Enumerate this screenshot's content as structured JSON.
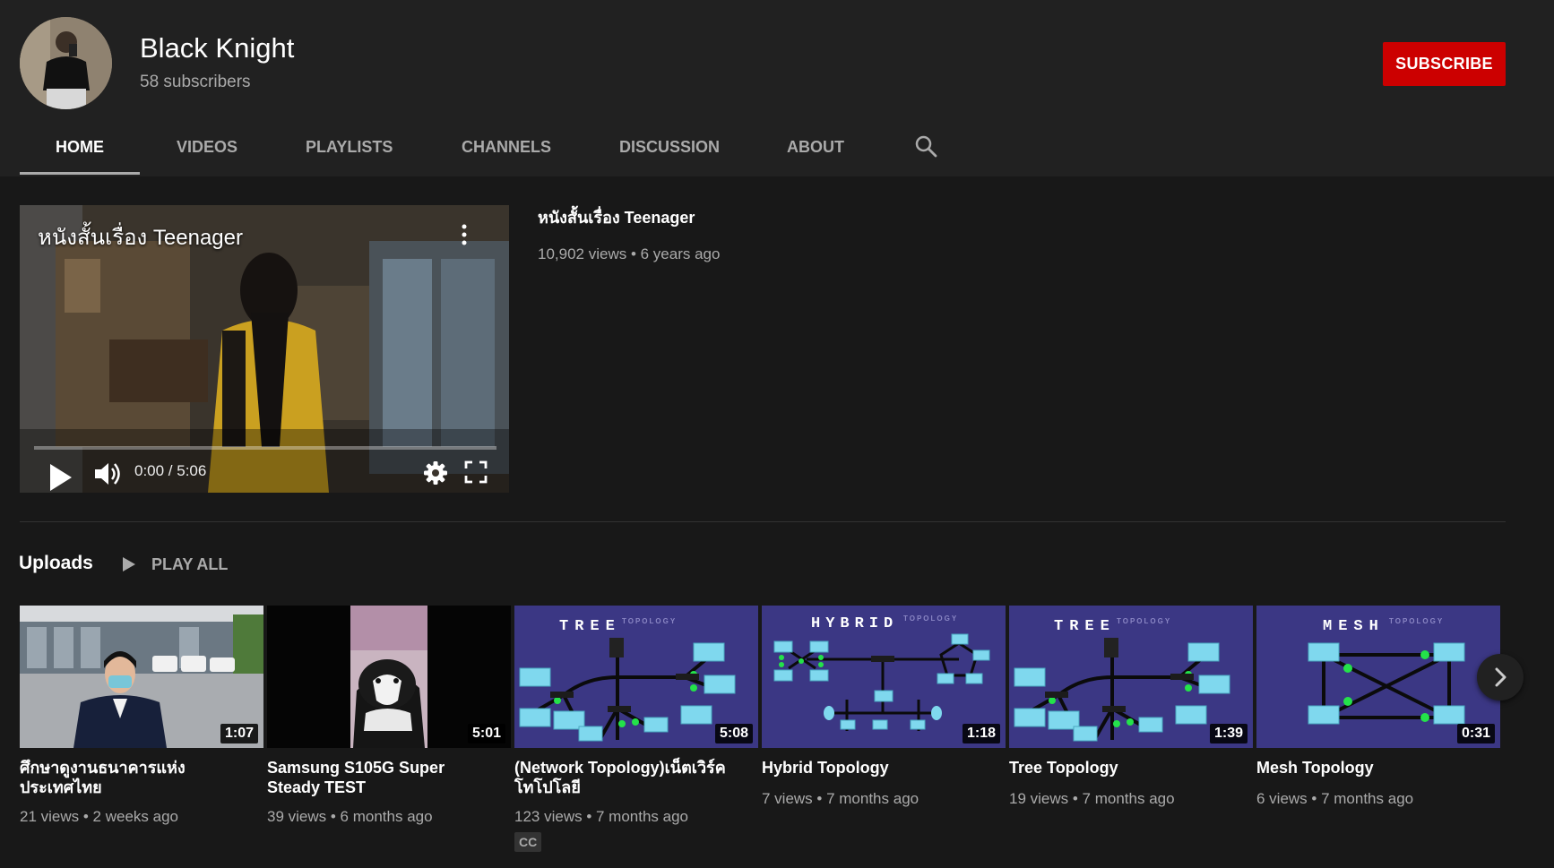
{
  "channel": {
    "name": "Black Knight",
    "subscribers": "58 subscribers",
    "subscribe_label": "SUBSCRIBE"
  },
  "tabs": [
    {
      "label": "HOME",
      "active": true
    },
    {
      "label": "VIDEOS",
      "active": false
    },
    {
      "label": "PLAYLISTS",
      "active": false
    },
    {
      "label": "CHANNELS",
      "active": false
    },
    {
      "label": "DISCUSSION",
      "active": false
    },
    {
      "label": "ABOUT",
      "active": false
    }
  ],
  "featured": {
    "overlay_title": "หนังสั้นเรื่อง Teenager",
    "title": "หนังสั้นเรื่อง Teenager",
    "meta": "10,902 views • 6 years ago",
    "time": "0:00 / 5:06",
    "progress": 0
  },
  "uploads": {
    "title": "Uploads",
    "play_all": "PLAY ALL",
    "videos": [
      {
        "title": "ศึกษาดูงานธนาคารแห่งประเทศไทย",
        "duration": "1:07",
        "meta": "21 views • 2 weeks ago",
        "thumb": "photo-person"
      },
      {
        "title": "Samsung S105G Super Steady TEST",
        "duration": "5:01",
        "meta": "39 views • 6 months ago",
        "thumb": "photo-cat"
      },
      {
        "title": "(Network Topology)เน็ตเวิร์ค โทโปโลยี",
        "duration": "5:08",
        "meta": "123 views • 7 months ago",
        "badge": "CC",
        "thumb": "tree-diagram",
        "thumb_heading": "TREE",
        "thumb_sub": "TOPOLOGY"
      },
      {
        "title": "Hybrid Topology",
        "duration": "1:18",
        "meta": "7 views • 7 months ago",
        "thumb": "hybrid-diagram",
        "thumb_heading": "HYBRID",
        "thumb_sub": "TOPOLOGY"
      },
      {
        "title": "Tree Topology",
        "duration": "1:39",
        "meta": "19 views • 7 months ago",
        "thumb": "tree-diagram",
        "thumb_heading": "TREE",
        "thumb_sub": "TOPOLOGY"
      },
      {
        "title": "Mesh Topology",
        "duration": "0:31",
        "meta": "6 views • 7 months ago",
        "thumb": "mesh-diagram",
        "thumb_heading": "MESH",
        "thumb_sub": "TOPOLOGY"
      }
    ]
  },
  "colors": {
    "background": "#181818",
    "header": "#212121",
    "subscribe": "#cc0000",
    "muted_text": "#aaaaaa",
    "diagram_bg": "#3b3784"
  },
  "icons": {
    "search": "search-icon",
    "play": "play-icon",
    "volume": "volume-icon",
    "settings": "gear-icon",
    "fullscreen": "fullscreen-icon",
    "menu": "more-vert-icon",
    "next": "chevron-right-icon",
    "play_all": "play-icon"
  }
}
